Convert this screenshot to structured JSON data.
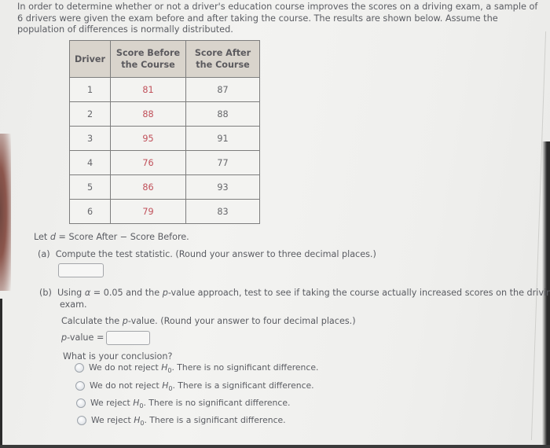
{
  "problem": {
    "intro": "In order to determine whether or not a driver's education course improves the scores on a driving exam, a sample of 6 drivers were given the exam before and after taking the course. The results are shown below. Assume the population of differences is normally distributed."
  },
  "table": {
    "headers": [
      "Driver",
      "Score Before the Course",
      "Score After the Course"
    ],
    "header_lines": [
      [
        "Driver"
      ],
      [
        "Score Before",
        "the Course"
      ],
      [
        "Score After",
        "the Course"
      ]
    ],
    "rows": [
      {
        "driver": "1",
        "before": "81",
        "after": "87"
      },
      {
        "driver": "2",
        "before": "88",
        "after": "88"
      },
      {
        "driver": "3",
        "before": "95",
        "after": "91"
      },
      {
        "driver": "4",
        "before": "76",
        "after": "77"
      },
      {
        "driver": "5",
        "before": "86",
        "after": "93"
      },
      {
        "driver": "6",
        "before": "79",
        "after": "83"
      }
    ],
    "before_color": "#c0505a"
  },
  "definition": {
    "prefix": "Let ",
    "var": "d",
    "rest": " = Score After − Score Before."
  },
  "part_a": {
    "label": "(a)",
    "prompt": "Compute the test statistic. (Round your answer to three decimal places.)",
    "answer_value": ""
  },
  "part_b": {
    "label": "(b)",
    "line1_pre": "Using ",
    "alpha": "α",
    "line1_mid": " = 0.05 and the ",
    "p": "p",
    "line1_post": "-value approach, test to see if taking the course actually increased scores on the driving",
    "line2": "exam.",
    "calc_pre": "Calculate the ",
    "calc_post": "-value. (Round your answer to four decimal places.)",
    "pvalue_label_post": "-value =",
    "pvalue_value": "",
    "conclusion_prompt": "What is your conclusion?",
    "options": [
      {
        "pre": "We do not reject ",
        "h": "H",
        "sub": "0",
        "post": ". There is no significant difference."
      },
      {
        "pre": "We do not reject ",
        "h": "H",
        "sub": "0",
        "post": ". There is a significant difference."
      },
      {
        "pre": "We reject ",
        "h": "H",
        "sub": "0",
        "post": ". There is no significant difference."
      },
      {
        "pre": "We reject ",
        "h": "H",
        "sub": "0",
        "post": ". There is a significant difference."
      }
    ]
  }
}
